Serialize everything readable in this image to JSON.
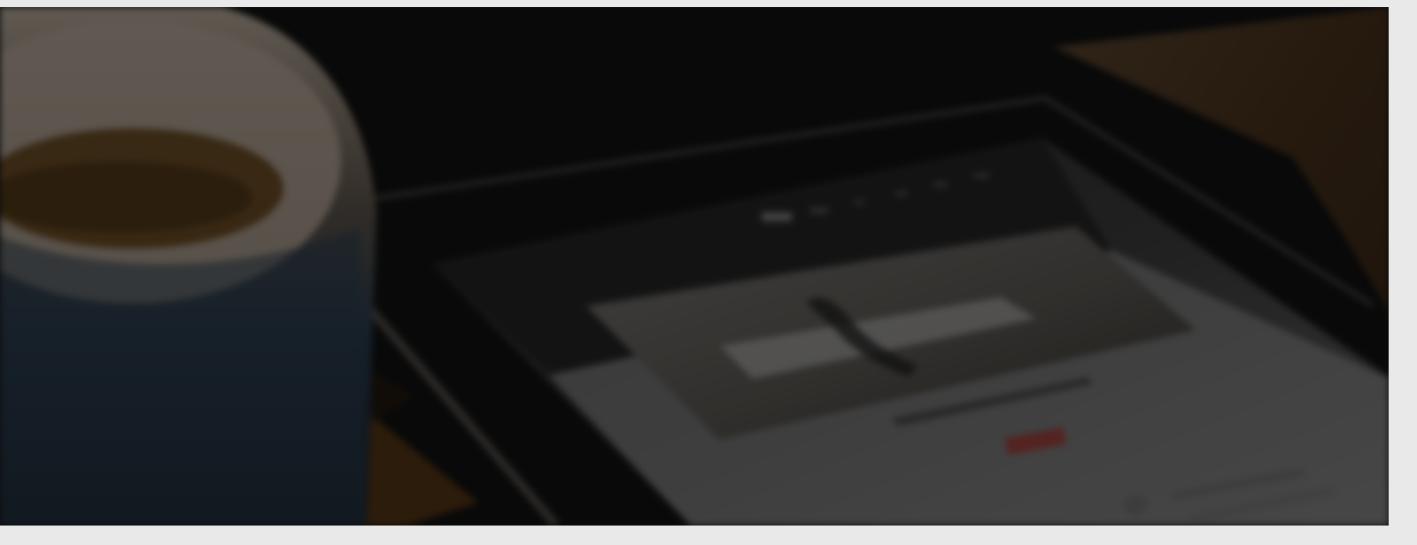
{
  "image": {
    "accessible_label": "",
    "colors": {
      "background": "#1b1b1c",
      "table_wood": "#8a5a2a",
      "tablet_bezel": "#161616",
      "screen_light": "#d9d9d9",
      "screen_dark": "#2d2d2d",
      "cup_rim": "#d8c7b5",
      "cup_blue": "#33485c",
      "accent_red": "#c73a30"
    },
    "icons": {
      "tablet": "tablet-icon",
      "cup": "cup-icon"
    }
  }
}
